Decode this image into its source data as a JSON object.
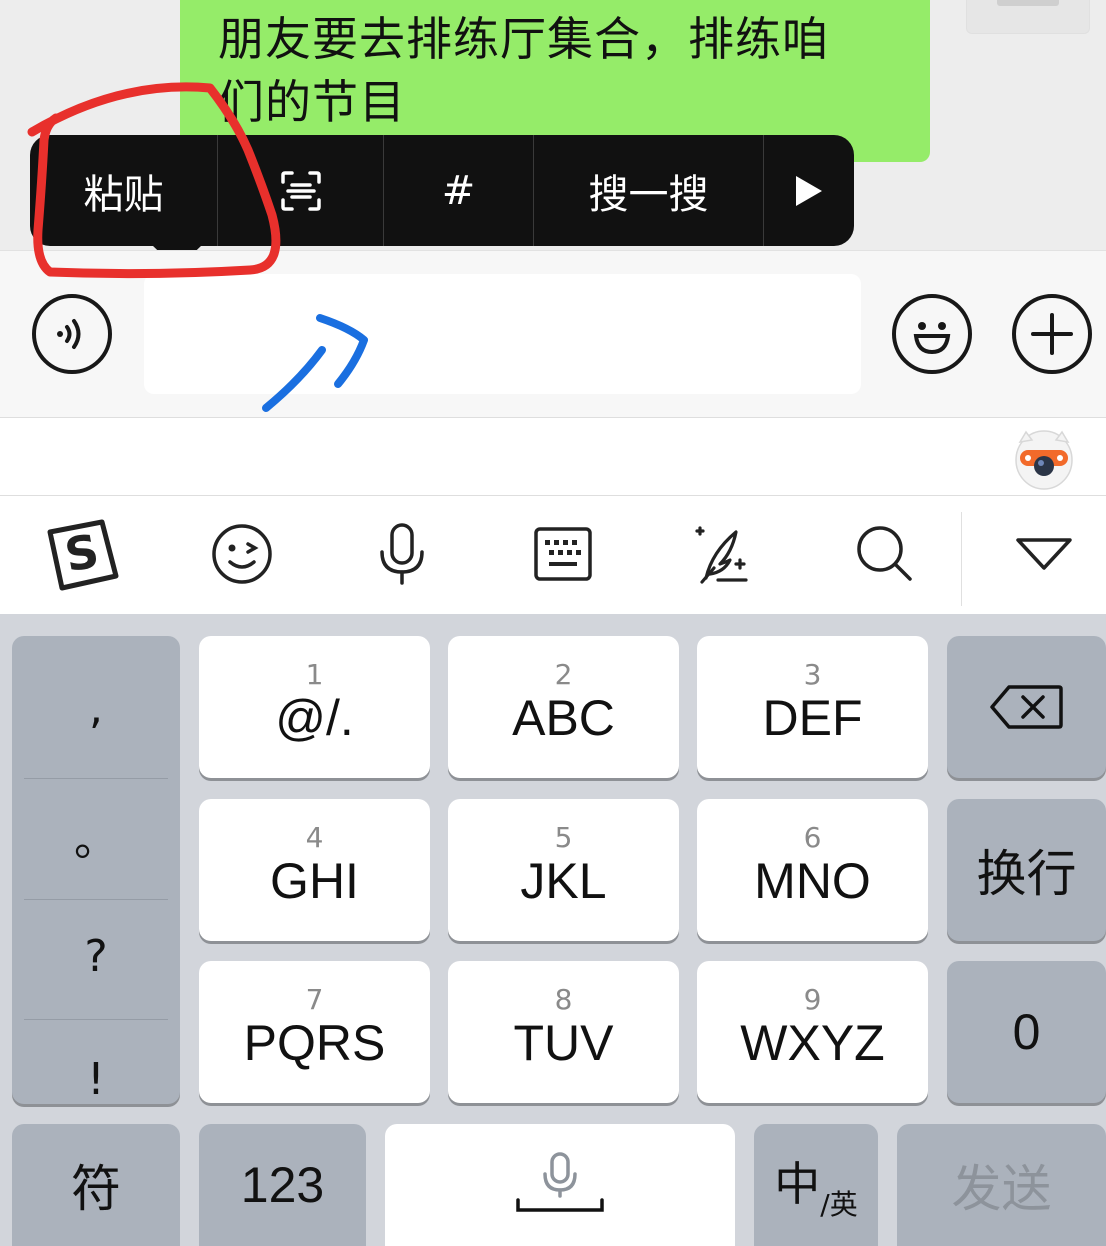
{
  "chat": {
    "bubble_line1": "朋友要去排练厅集合，排练咱",
    "bubble_line2": "们的节目"
  },
  "context_menu": {
    "paste": "粘贴",
    "hashtag": "#",
    "search": "搜一搜",
    "scan_icon": "scan-text-icon",
    "more_icon": "play-triangle-icon"
  },
  "input_bar": {
    "value": "",
    "placeholder": ""
  },
  "ime_toolbar": {
    "icons": [
      "sogou-logo",
      "emoji-icon",
      "microphone-icon",
      "keyboard-icon",
      "handwriting-icon",
      "search-icon",
      "collapse-icon"
    ]
  },
  "keyboard": {
    "punctuation": [
      ",",
      "。",
      "?",
      "!"
    ],
    "keys": [
      {
        "num": "1",
        "letters": "@/."
      },
      {
        "num": "2",
        "letters": "ABC"
      },
      {
        "num": "3",
        "letters": "DEF"
      },
      {
        "num": "4",
        "letters": "GHI"
      },
      {
        "num": "5",
        "letters": "JKL"
      },
      {
        "num": "6",
        "letters": "MNO"
      },
      {
        "num": "7",
        "letters": "PQRS"
      },
      {
        "num": "8",
        "letters": "TUV"
      },
      {
        "num": "9",
        "letters": "WXYZ"
      }
    ],
    "newline": "换行",
    "zero": "0",
    "symbols": "符",
    "numbers": "123",
    "lang_main": "中",
    "lang_sub": "/英",
    "send": "发送"
  },
  "colors": {
    "bubble": "#95ec69",
    "menu_bg": "#111111",
    "annotation_red": "#e8302c",
    "annotation_blue": "#1a6fe0",
    "key_light": "#ffffff",
    "key_dark": "#abb2bc",
    "keyboard_bg": "#d2d5db"
  }
}
